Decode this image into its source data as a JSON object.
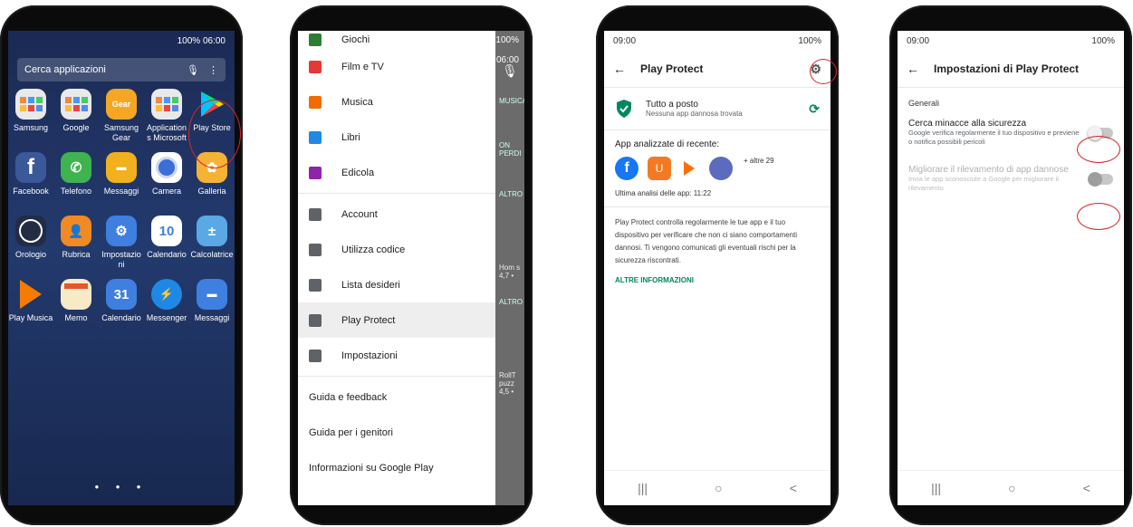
{
  "phone1": {
    "status": "100% 06:00",
    "search_placeholder": "Cerca applicazioni",
    "apps": [
      {
        "label": "Samsung",
        "icon": "folder-icon",
        "color": "#e9e9e9"
      },
      {
        "label": "Google",
        "icon": "folder-icon",
        "color": "#e9e9e9"
      },
      {
        "label": "Samsung Gear",
        "icon": "gear-app-icon",
        "color": "#f5a623"
      },
      {
        "label": "Application s Microsoft",
        "icon": "folder-icon",
        "color": "#e9e9e9"
      },
      {
        "label": "Play Store",
        "icon": "play-store-icon",
        "color": "transparent"
      },
      {
        "label": "Facebook",
        "icon": "facebook-icon",
        "color": "#3b5998"
      },
      {
        "label": "Telefono",
        "icon": "phone-icon",
        "color": "#3fb34f"
      },
      {
        "label": "Messaggi",
        "icon": "messages-icon",
        "color": "#f2b01e"
      },
      {
        "label": "Camera",
        "icon": "camera-icon",
        "color": "#ffffff"
      },
      {
        "label": "Galleria",
        "icon": "gallery-icon",
        "color": "#f5b335"
      },
      {
        "label": "Orologio",
        "icon": "clock-icon",
        "color": "#222c44"
      },
      {
        "label": "Rubrica",
        "icon": "contacts-icon",
        "color": "#f08a24"
      },
      {
        "label": "Impostazio ni",
        "icon": "settings-icon",
        "color": "#3f7fe0"
      },
      {
        "label": "Calendario",
        "icon": "calendar-icon",
        "color": "#ffffff"
      },
      {
        "label": "Calcolatrice",
        "icon": "calculator-icon",
        "color": "#5aa8e6"
      },
      {
        "label": "Play Musica",
        "icon": "play-music-icon",
        "color": "#f57c00"
      },
      {
        "label": "Memo",
        "icon": "memo-icon",
        "color": "#f8e9c7"
      },
      {
        "label": "Calendario",
        "icon": "calendar-icon",
        "color": "#3f7fe0"
      },
      {
        "label": "Messenger",
        "icon": "messenger-icon",
        "color": "#1e88e5"
      },
      {
        "label": "Messaggi",
        "icon": "messages-icon",
        "color": "#3f7fe0"
      }
    ],
    "cal_day": "10",
    "cal_day2": "31",
    "page_dots": "● ● ●"
  },
  "phone2": {
    "status": "100% 06:00",
    "menu": [
      {
        "label": "Giochi",
        "icon": "games-icon",
        "color": "#2e7d32"
      },
      {
        "label": "Film e TV",
        "icon": "movies-icon",
        "color": "#e53935"
      },
      {
        "label": "Musica",
        "icon": "music-icon",
        "color": "#ef6c00"
      },
      {
        "label": "Libri",
        "icon": "books-icon",
        "color": "#1e88e5"
      },
      {
        "label": "Edicola",
        "icon": "newsstand-icon",
        "color": "#8e24aa"
      }
    ],
    "menu2": [
      {
        "label": "Account",
        "icon": "account-icon"
      },
      {
        "label": "Utilizza codice",
        "icon": "redeem-icon"
      },
      {
        "label": "Lista desideri",
        "icon": "wishlist-icon"
      },
      {
        "label": "Play Protect",
        "icon": "shield-icon"
      },
      {
        "label": "Impostazioni",
        "icon": "settings-icon"
      }
    ],
    "menu3": [
      "Guida e feedback",
      "Guida per i genitori",
      "Informazioni su Google Play"
    ],
    "bg_texts": [
      "MUSICA",
      "ON PERDI",
      "ALTRO",
      "Hom s",
      "4,7 •",
      "ALTRO",
      "RollT puzz",
      "4,5 •"
    ]
  },
  "phone3": {
    "time": "09:00",
    "battery": "100%",
    "title": "Play Protect",
    "status_title": "Tutto a posto",
    "status_sub": "Nessuna app dannosa trovata",
    "recent_title": "App analizzate di recente:",
    "more_apps": "+ altre 29",
    "last_scan": "Ultima analisi delle app: 11:22",
    "description": "Play Protect controlla regolarmente le tue app e il tuo dispositivo per verificare che non ci siano comportamenti dannosi. Ti vengono comunicati gli eventuali rischi per la sicurezza riscontrati.",
    "link": "ALTRE INFORMAZIONI"
  },
  "phone4": {
    "time": "09:00",
    "battery": "100%",
    "title": "Impostazioni di Play Protect",
    "section": "Generali",
    "opt1_title": "Cerca minacce alla sicurezza",
    "opt1_desc": "Google verifica regolarmente il tuo dispositivo e previene o notifica possibili pericoli",
    "opt2_title": "Migliorare il rilevamento di app dannose",
    "opt2_desc": "Invia le app sconosciute a Google per migliorare il rilevamento"
  },
  "navbar": {
    "recent": "|||",
    "home": "○",
    "back": "<"
  },
  "colors": {
    "accent_red": "#d6252b",
    "play_green": "#01875f"
  }
}
